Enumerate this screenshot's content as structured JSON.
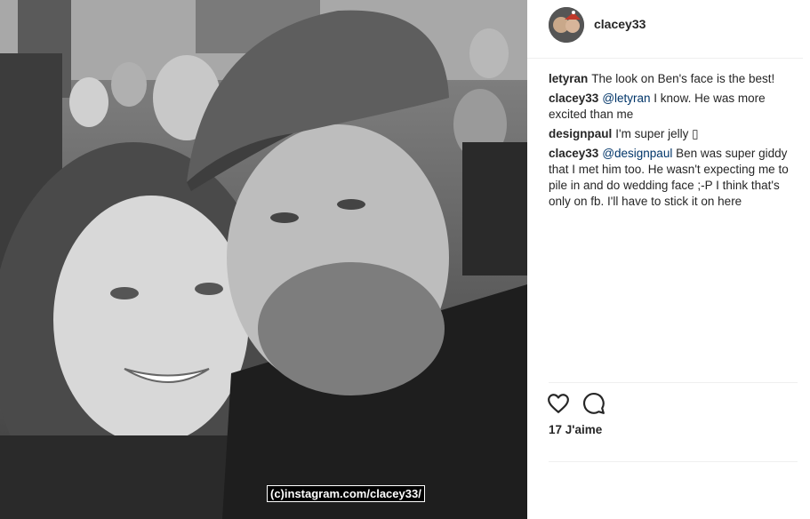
{
  "header": {
    "username": "clacey33"
  },
  "comments": [
    {
      "user": "letyran",
      "mention": "",
      "text": "The look on Ben's face is the best!"
    },
    {
      "user": "clacey33",
      "mention": "@letyran",
      "text": " I know. He was more excited than me"
    },
    {
      "user": "designpaul",
      "mention": "",
      "text": "I'm super jelly ▯"
    },
    {
      "user": "clacey33",
      "mention": "@designpaul",
      "text": " Ben was super giddy that I met him too. He wasn't expecting me to pile in and do wedding face ;-P I think that's only on fb. I'll have to stick it on here"
    }
  ],
  "likes": {
    "text": "17 J'aime"
  },
  "watermark": {
    "text": "(c)instagram.com/clacey33/"
  },
  "icons": {
    "like": "heart-icon",
    "comment": "comment-bubble-icon"
  },
  "colors": {
    "text": "#262626",
    "mention": "#003569",
    "divider": "#efefef"
  }
}
